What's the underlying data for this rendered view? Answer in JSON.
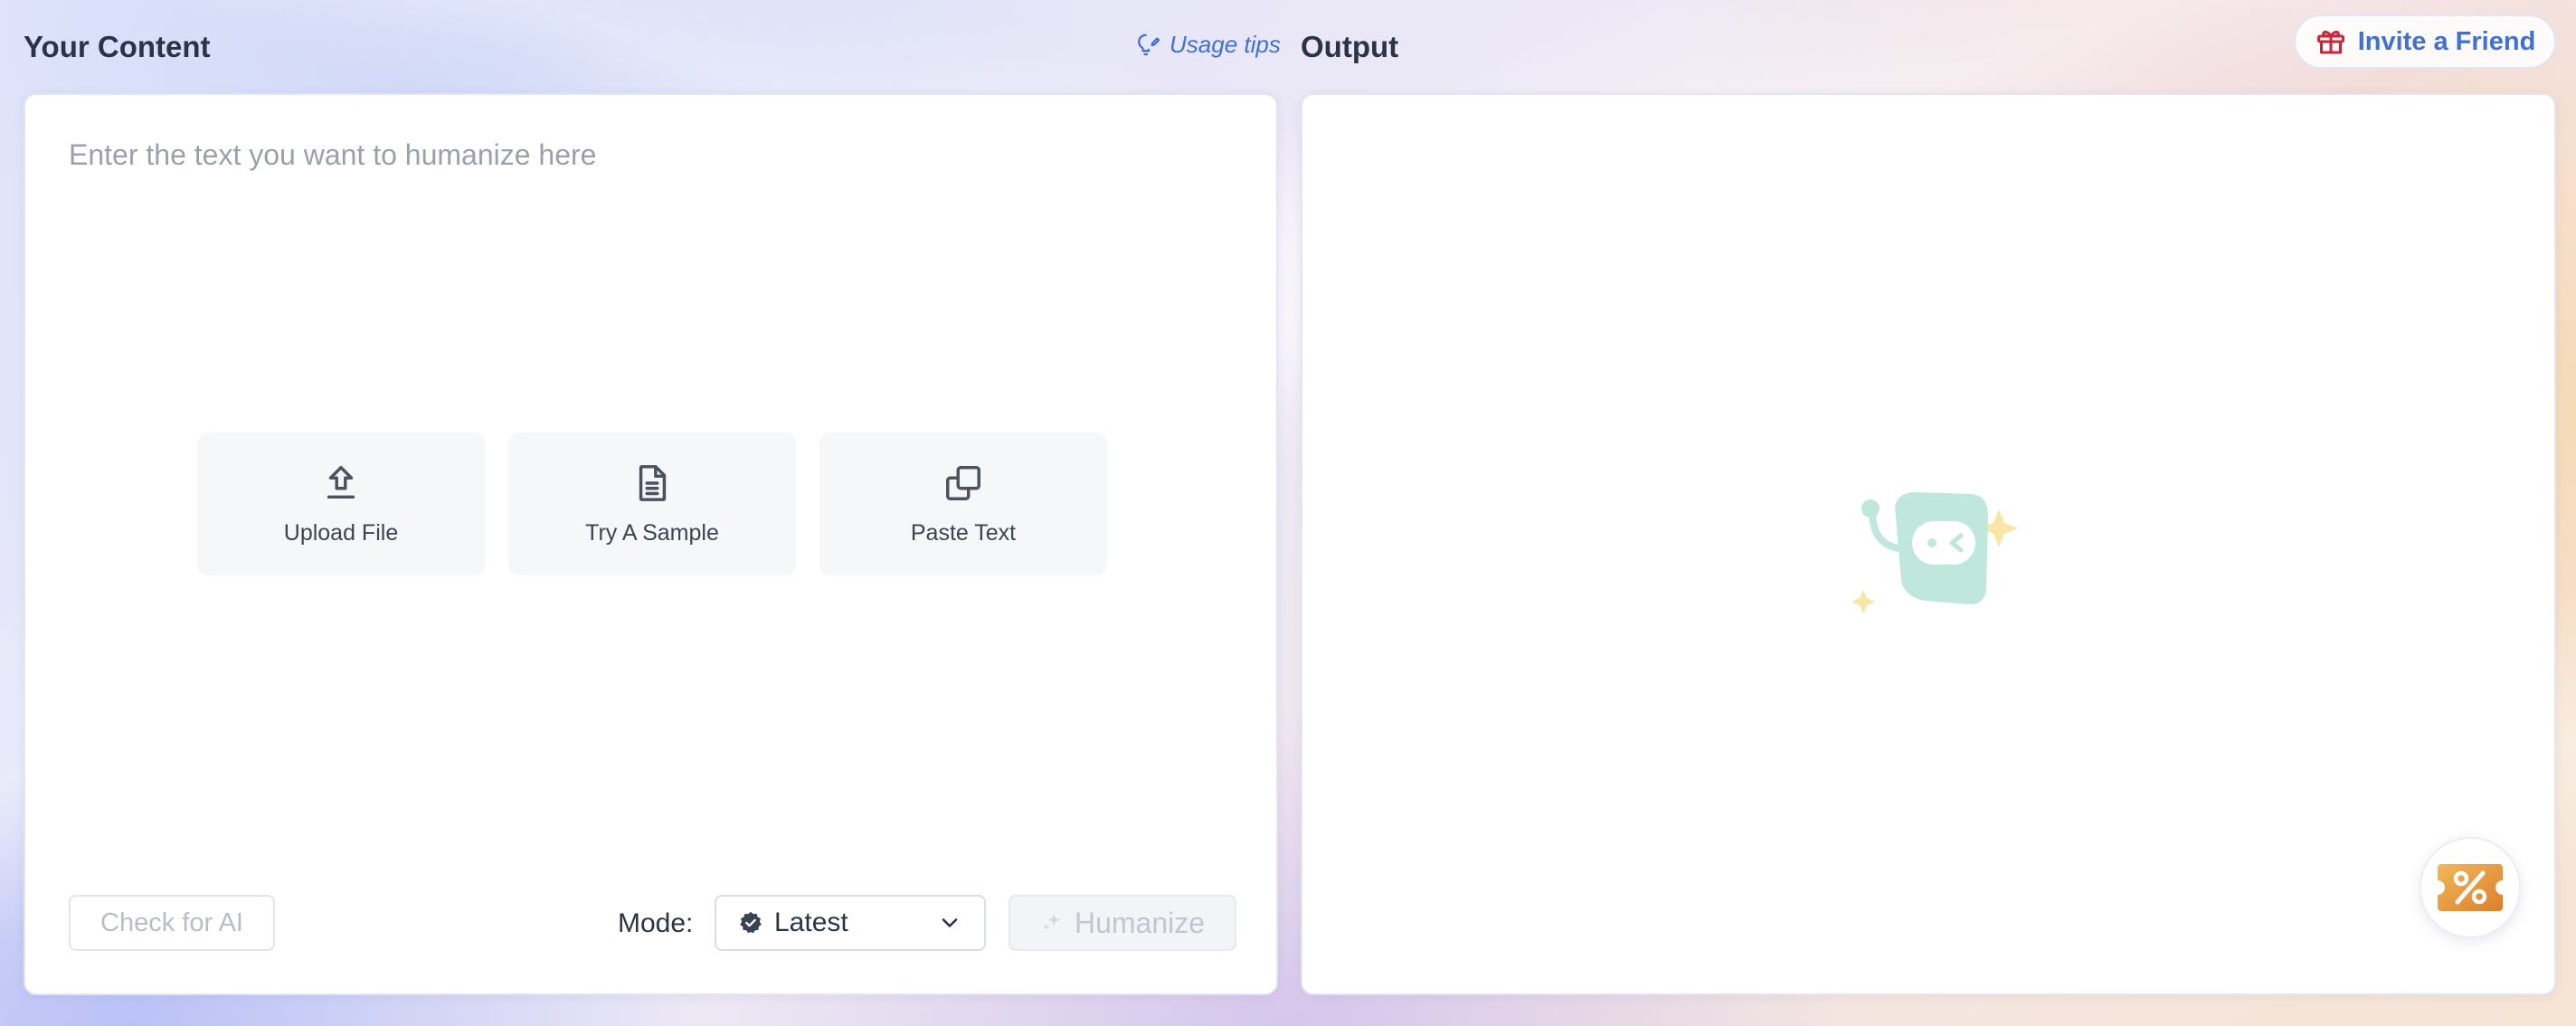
{
  "header": {
    "input_title": "Your Content",
    "usage_tips": "Usage tips",
    "output_title": "Output",
    "invite_label": "Invite a Friend"
  },
  "input_panel": {
    "placeholder": "Enter the text you want to humanize here",
    "actions": [
      {
        "label": "Upload File",
        "icon": "upload-icon"
      },
      {
        "label": "Try A Sample",
        "icon": "document-icon"
      },
      {
        "label": "Paste Text",
        "icon": "copy-icon"
      }
    ],
    "check_ai_label": "Check for AI",
    "mode_label": "Mode:",
    "mode_value": "Latest",
    "humanize_label": "Humanize"
  },
  "colors": {
    "accent": "#3f6fd8",
    "gift_red": "#c8283a",
    "mascot_mint": "#bfe7dc",
    "sparkle_yellow": "#f7e6a4",
    "coupon_orange": "#e69a3a"
  }
}
